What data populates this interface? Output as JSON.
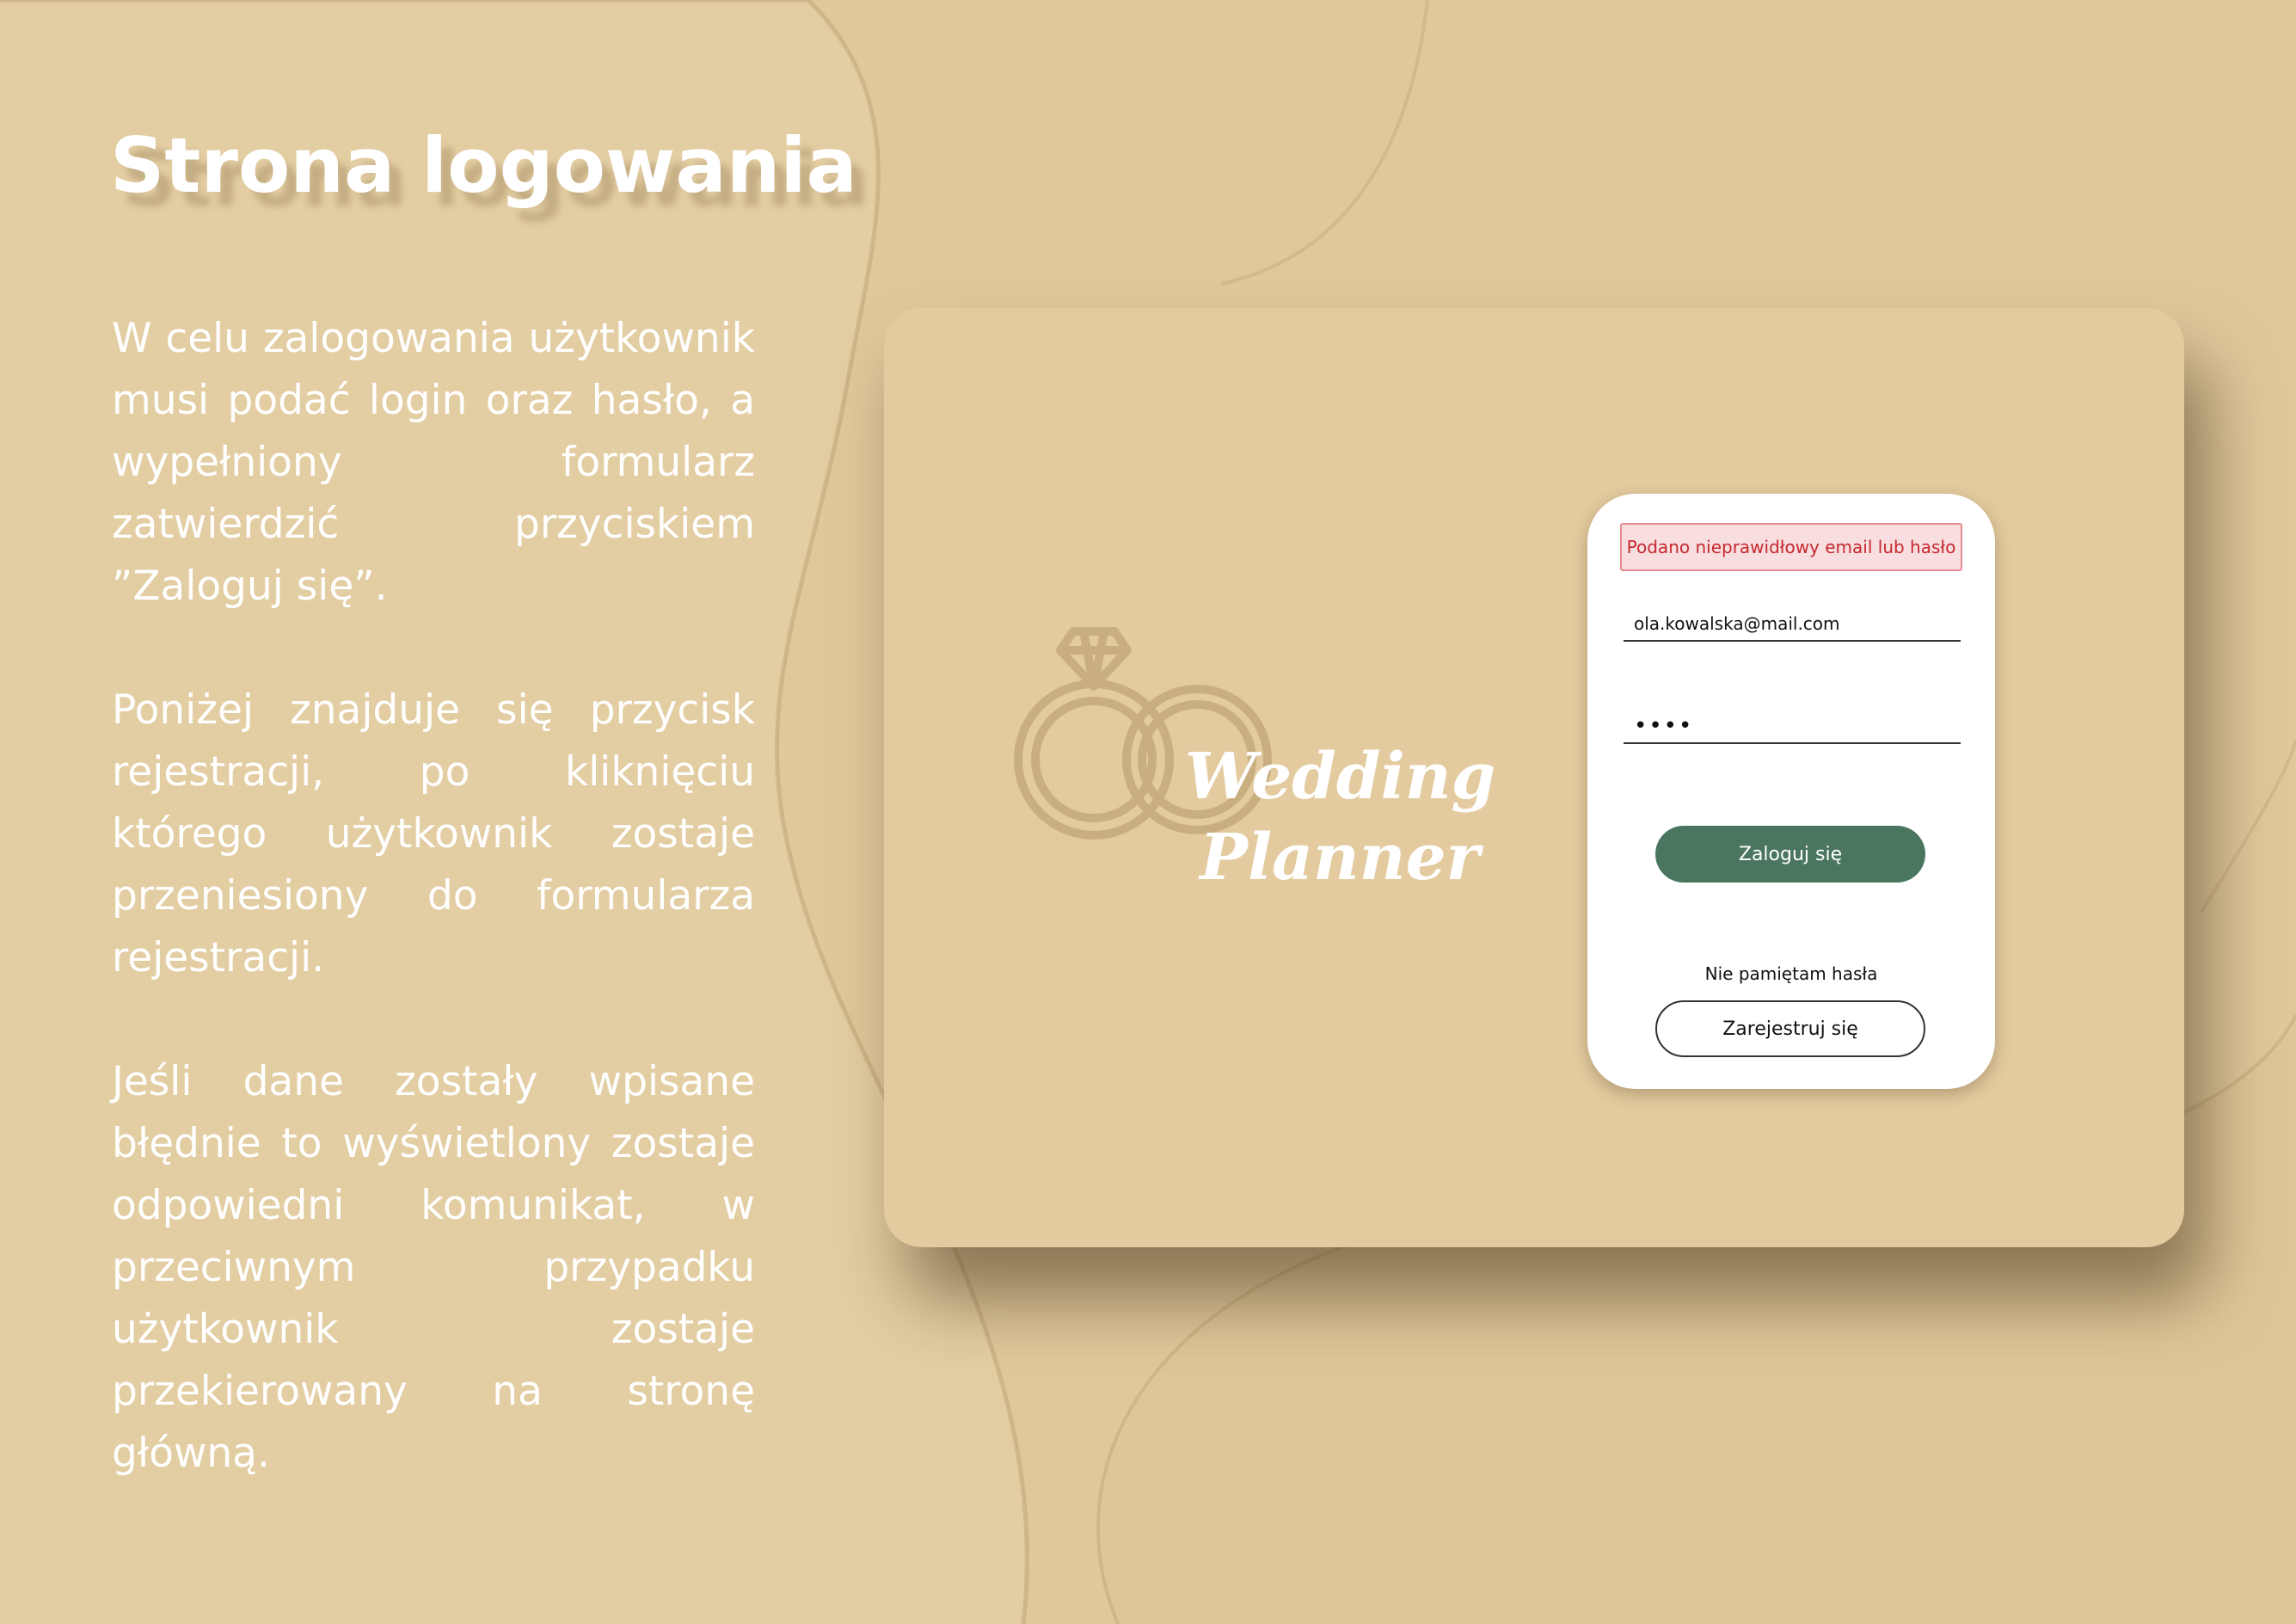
{
  "slide": {
    "title": "Strona logowania",
    "paragraphs": [
      "W celu zalogowania użytkownik musi podać login oraz hasło, a wypełniony formularz zatwierdzić przyciskiem ”Zaloguj się”.",
      "Poniżej znajduje się przycisk rejestracji, po kliknięciu którego użytkownik zostaje przeniesiony do formularza rejestracji.",
      "Jeśli dane zostały wpisane błędnie to wyświetlony zostaje odpowiedni komunikat, w przeciwnym przypadku użytkownik zostaje przekierowany na stronę główną."
    ]
  },
  "app": {
    "logo": {
      "line1": "Wedding",
      "line2": "Planner",
      "icon": "wedding-rings-icon"
    },
    "login": {
      "error_message": "Podano nieprawidłowy email lub hasło",
      "email_value": "ola.kowalska@mail.com",
      "password_value": "••••",
      "login_button": "Zaloguj się",
      "forgot_password": "Nie pamiętam hasła",
      "register_button": "Zarejestruj się"
    }
  },
  "colors": {
    "background": "#e0c89c",
    "window": "#e3cb9f",
    "accent_green": "#4a7660",
    "error_red": "#c62931",
    "error_bg": "#f8dede"
  }
}
